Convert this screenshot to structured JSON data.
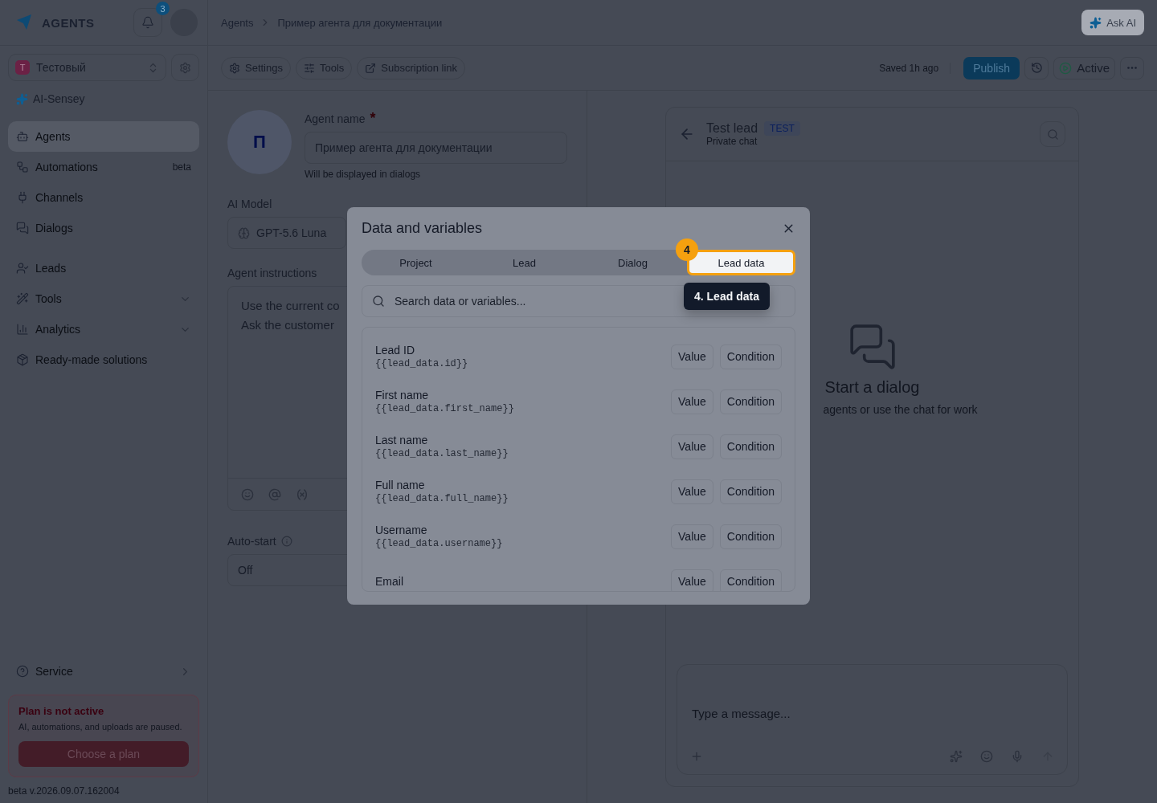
{
  "header": {
    "logo": "AGENTS",
    "notifications": "3",
    "breadcrumb": [
      "Agents",
      "Пример агента для документации"
    ],
    "ask_ai": "Ask AI"
  },
  "sidebar": {
    "workspace": {
      "initial": "Т",
      "name": "Тестовый"
    },
    "brand": "AI-Sensey",
    "groups": [
      [
        {
          "label": "Agents",
          "selected": true,
          "expandable": false
        },
        {
          "label": "Automations",
          "badge": "beta",
          "selected": false,
          "expandable": false
        },
        {
          "label": "Channels",
          "selected": false,
          "expandable": false
        },
        {
          "label": "Dialogs",
          "selected": false,
          "expandable": false
        }
      ],
      [
        {
          "label": "Leads",
          "selected": false,
          "expandable": false
        },
        {
          "label": "Tools",
          "selected": false,
          "expandable": true
        },
        {
          "label": "Analytics",
          "selected": false,
          "expandable": true
        },
        {
          "label": "Ready-made solutions",
          "selected": false,
          "expandable": false
        }
      ]
    ],
    "service": "Service",
    "plan": {
      "title": "Plan is not active",
      "text": "AI, automations, and uploads are paused.",
      "button": "Choose a plan"
    },
    "version": "beta v.2026.09.07.162004"
  },
  "toolbar": {
    "tabs": [
      "Settings",
      "Tools",
      "Subscription link"
    ],
    "saved": "Saved 1h ago",
    "publish": "Publish",
    "status": "Active"
  },
  "form": {
    "avatar": "П",
    "name_label": "Agent name",
    "required": "*",
    "name_value": "Пример агента для документации",
    "name_hint": "Will be displayed in dialogs",
    "model_label": "AI Model",
    "model_value": "GPT-5.6 Luna",
    "instructions_label": "Agent instructions",
    "instructions_lines": [
      "Use the current co",
      "Ask the customer"
    ],
    "autostart_label": "Auto-start",
    "autostart_value": "Off"
  },
  "chat": {
    "title": "Test lead",
    "tag": "TEST",
    "subtitle": "Private chat",
    "empty_title": "Start a dialog",
    "empty_text": "agents or use the chat for work",
    "placeholder": "Type a message..."
  },
  "modal": {
    "title": "Data and variables",
    "tabs": [
      {
        "label": "Project",
        "selected": false
      },
      {
        "label": "Lead",
        "selected": false
      },
      {
        "label": "Dialog",
        "selected": false
      },
      {
        "label": "Lead data",
        "selected": true
      }
    ],
    "search_placeholder": "Search data or variables...",
    "step": "4",
    "tooltip": "4. Lead data",
    "rows": [
      {
        "label": "Lead ID",
        "code": "{{lead_data.id}}",
        "actions": [
          "Value",
          "Condition"
        ]
      },
      {
        "label": "First name",
        "code": "{{lead_data.first_name}}",
        "actions": [
          "Value",
          "Condition"
        ]
      },
      {
        "label": "Last name",
        "code": "{{lead_data.last_name}}",
        "actions": [
          "Value",
          "Condition"
        ]
      },
      {
        "label": "Full name",
        "code": "{{lead_data.full_name}}",
        "actions": [
          "Value",
          "Condition"
        ]
      },
      {
        "label": "Username",
        "code": "{{lead_data.username}}",
        "actions": [
          "Value",
          "Condition"
        ]
      },
      {
        "label": "Email",
        "actions": [
          "Value",
          "Condition"
        ]
      }
    ]
  }
}
